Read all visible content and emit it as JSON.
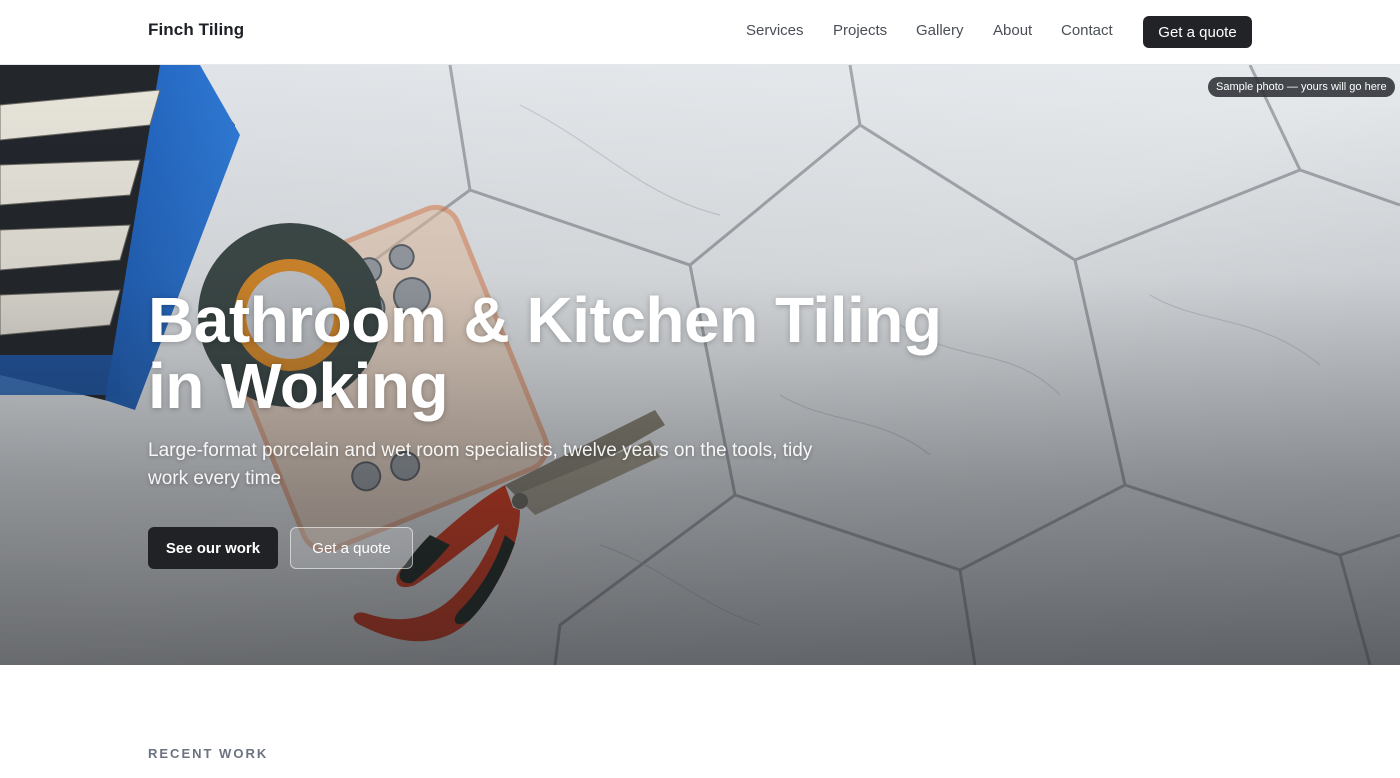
{
  "header": {
    "brand": "Finch Tiling",
    "nav": [
      "Services",
      "Projects",
      "Gallery",
      "About",
      "Contact"
    ],
    "cta": "Get a quote"
  },
  "hero": {
    "badge": "Sample photo — yours will go here",
    "title": "Bathroom & Kitchen Tiling in Woking",
    "subtitle": "Large-format porcelain and wet room specialists, twelve years on the tools, tidy work every time",
    "primary_button": "See our work",
    "secondary_button": "Get a quote"
  },
  "recent_work": {
    "label": "RECENT WORK"
  },
  "colors": {
    "dark": "#222327",
    "tile": "#e9ecef",
    "accent_red": "#d93a1c"
  }
}
